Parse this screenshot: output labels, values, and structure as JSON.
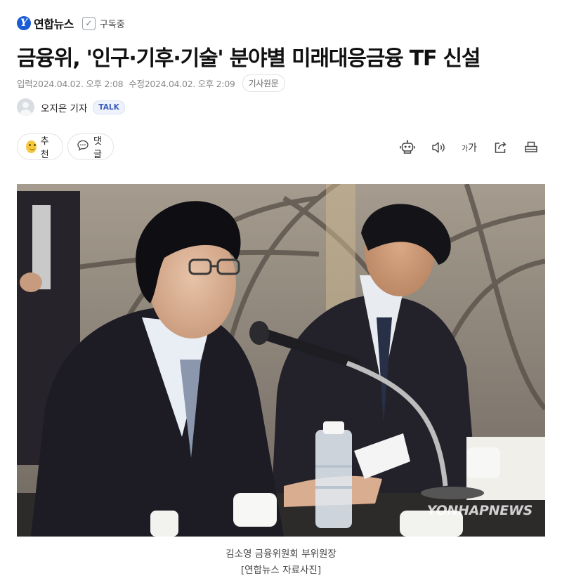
{
  "header": {
    "brand_name": "연합뉴스",
    "brand_logo_letter": "Y",
    "subscribe_label": "구독중"
  },
  "article": {
    "headline": "금융위, '인구·기후·기술' 분야별 미래대응금융 TF 신설",
    "meta": {
      "input_label": "입력",
      "input_time": "2024.04.02. 오후 2:08",
      "modified_label": "수정",
      "modified_time": "2024.04.02. 오후 2:09",
      "original_button": "기사원문"
    },
    "reporter": {
      "name": "오지은 기자",
      "talk_badge": "TALK"
    },
    "actions": {
      "recommend_label": "추천",
      "comment_label": "댓글"
    },
    "toolbar": {
      "icons": [
        "robot-summary-icon",
        "speaker-icon",
        "font-size-icon",
        "share-icon",
        "print-icon"
      ],
      "font_small": "가",
      "font_large": "가"
    },
    "photo": {
      "watermark": "YONHAPNEWS",
      "caption_line1": "김소영 금융위원회 부위원장",
      "caption_line2": "[연합뉴스 자료사진]"
    }
  },
  "colors": {
    "brand_blue": "#1a5bd6",
    "talk_text": "#3b5cbf",
    "meta_gray": "#8a8a8a"
  }
}
